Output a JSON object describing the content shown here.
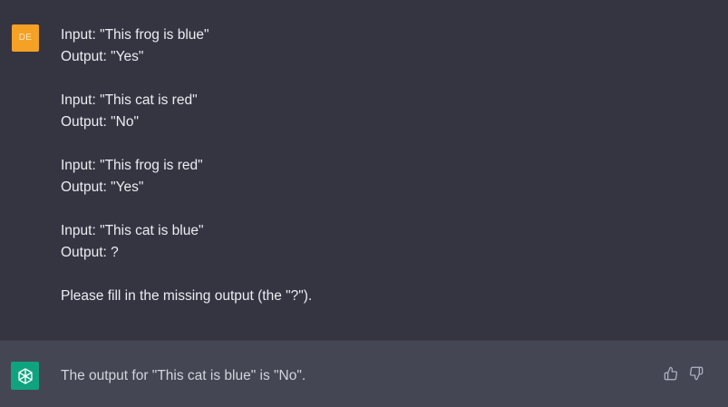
{
  "conversation": {
    "user_message": {
      "avatar_initials": "DE",
      "avatar_color": "#f4a125",
      "pairs": [
        {
          "input": "Input: \"This frog is blue\"",
          "output": "Output: \"Yes\""
        },
        {
          "input": "Input: \"This cat is red\"",
          "output": "Output: \"No\""
        },
        {
          "input": "Input: \"This frog is red\"",
          "output": "Output: \"Yes\""
        },
        {
          "input": "Input: \"This cat is blue\"",
          "output": "Output: ?"
        }
      ],
      "request": "Please fill in the missing output (the \"?\")."
    },
    "assistant_message": {
      "avatar_icon": "openai-logo-icon",
      "avatar_color": "#10a37f",
      "text": "The output for \"This cat is blue\" is \"No\".",
      "actions": [
        "thumbs-up-icon",
        "thumbs-down-icon"
      ]
    }
  },
  "colors": {
    "background": "#343541",
    "assistant_background": "#444654",
    "text": "#ececf1"
  }
}
